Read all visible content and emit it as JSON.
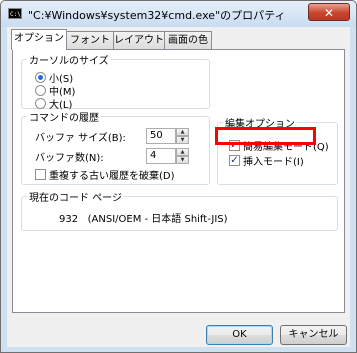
{
  "window": {
    "icon_text": "C:\\",
    "title": "\"C:¥Windows¥system32¥cmd.exe\"のプロパティ",
    "close_glyph": "✕"
  },
  "tabs": [
    {
      "label": "オプション",
      "active": true
    },
    {
      "label": "フォント",
      "active": false
    },
    {
      "label": "レイアウト",
      "active": false
    },
    {
      "label": "画面の色",
      "active": false
    }
  ],
  "cursor_size": {
    "legend": "カーソルのサイズ",
    "options": [
      {
        "label": "小(S)",
        "selected": true
      },
      {
        "label": "中(M)",
        "selected": false
      },
      {
        "label": "大(L)",
        "selected": false
      }
    ]
  },
  "history": {
    "legend": "コマンドの履歴",
    "buffer_size_label": "バッファ サイズ(B):",
    "buffer_size_value": "50",
    "buffer_count_label": "バッファ数(N):",
    "buffer_count_value": "4",
    "discard_old_label": "重複する古い履歴を破棄(D)",
    "discard_old_checked": false
  },
  "edit_options": {
    "legend": "編集オプション",
    "quick_edit_label": "簡易編集モード(Q)",
    "quick_edit_checked": true,
    "insert_mode_label": "挿入モード(I)",
    "insert_mode_checked": true
  },
  "code_page": {
    "legend": "現在のコード ページ",
    "value": "932   (ANSI/OEM - 日本語 Shift-JIS)"
  },
  "buttons": {
    "ok": "OK",
    "cancel": "キャンセル"
  },
  "glyphs": {
    "check": "✓",
    "up": "▲",
    "down": "▼"
  },
  "colors": {
    "highlight": "#ff0000",
    "radio_dot": "#2a6bd4"
  }
}
